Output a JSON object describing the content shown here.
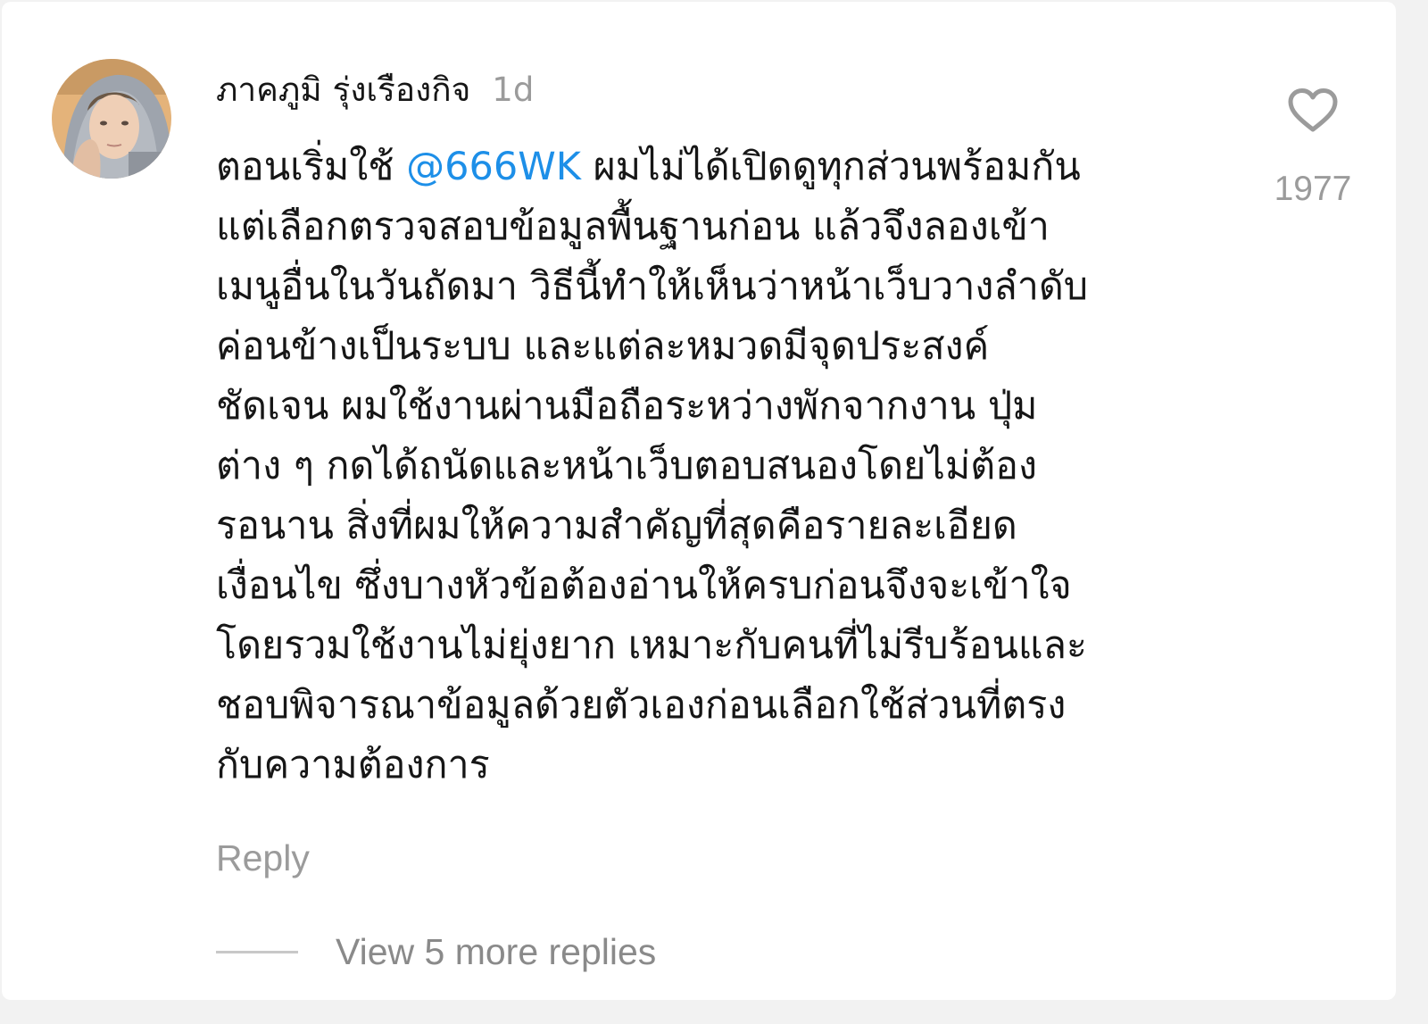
{
  "comment": {
    "username": "ภาคภูมิ รุ่งเรืองกิจ",
    "timestamp": "1d",
    "mention": "@666WK",
    "text_first_before": "ตอนเริ่มใช้ ",
    "text_first_after": " ผมไม่ได้เปิดดูทุกส่วนพร้อมกัน",
    "text_lines": [
      "แต่เลือกตรวจสอบข้อมูลพื้นฐานก่อน แล้วจึงลองเข้า",
      "เมนูอื่นในวันถัดมา วิธีนี้ทำให้เห็นว่าหน้าเว็บวางลำดับ",
      "ค่อนข้างเป็นระบบ และแต่ละหมวดมีจุดประสงค์",
      "ชัดเจน ผมใช้งานผ่านมือถือระหว่างพักจากงาน ปุ่ม",
      "ต่าง ๆ กดได้ถนัดและหน้าเว็บตอบสนองโดยไม่ต้อง",
      "รอนาน สิ่งที่ผมให้ความสำคัญที่สุดคือรายละเอียด",
      "เงื่อนไข ซึ่งบางหัวข้อต้องอ่านให้ครบก่อนจึงจะเข้าใจ",
      "โดยรวมใช้งานไม่ยุ่งยาก เหมาะกับคนที่ไม่รีบร้อนและ",
      "ชอบพิจารณาข้อมูลด้วยตัวเองก่อนเลือกใช้ส่วนที่ตรง",
      "กับความต้องการ"
    ],
    "like_count": "1977",
    "reply_label": "Reply",
    "view_replies_label": "View 5 more replies"
  },
  "icons": {
    "like": "heart-outline-icon",
    "avatar": "user-avatar"
  },
  "colors": {
    "mention": "#1d8fe8",
    "muted_text": "#9b9b9b",
    "primary_text": "#161616"
  }
}
